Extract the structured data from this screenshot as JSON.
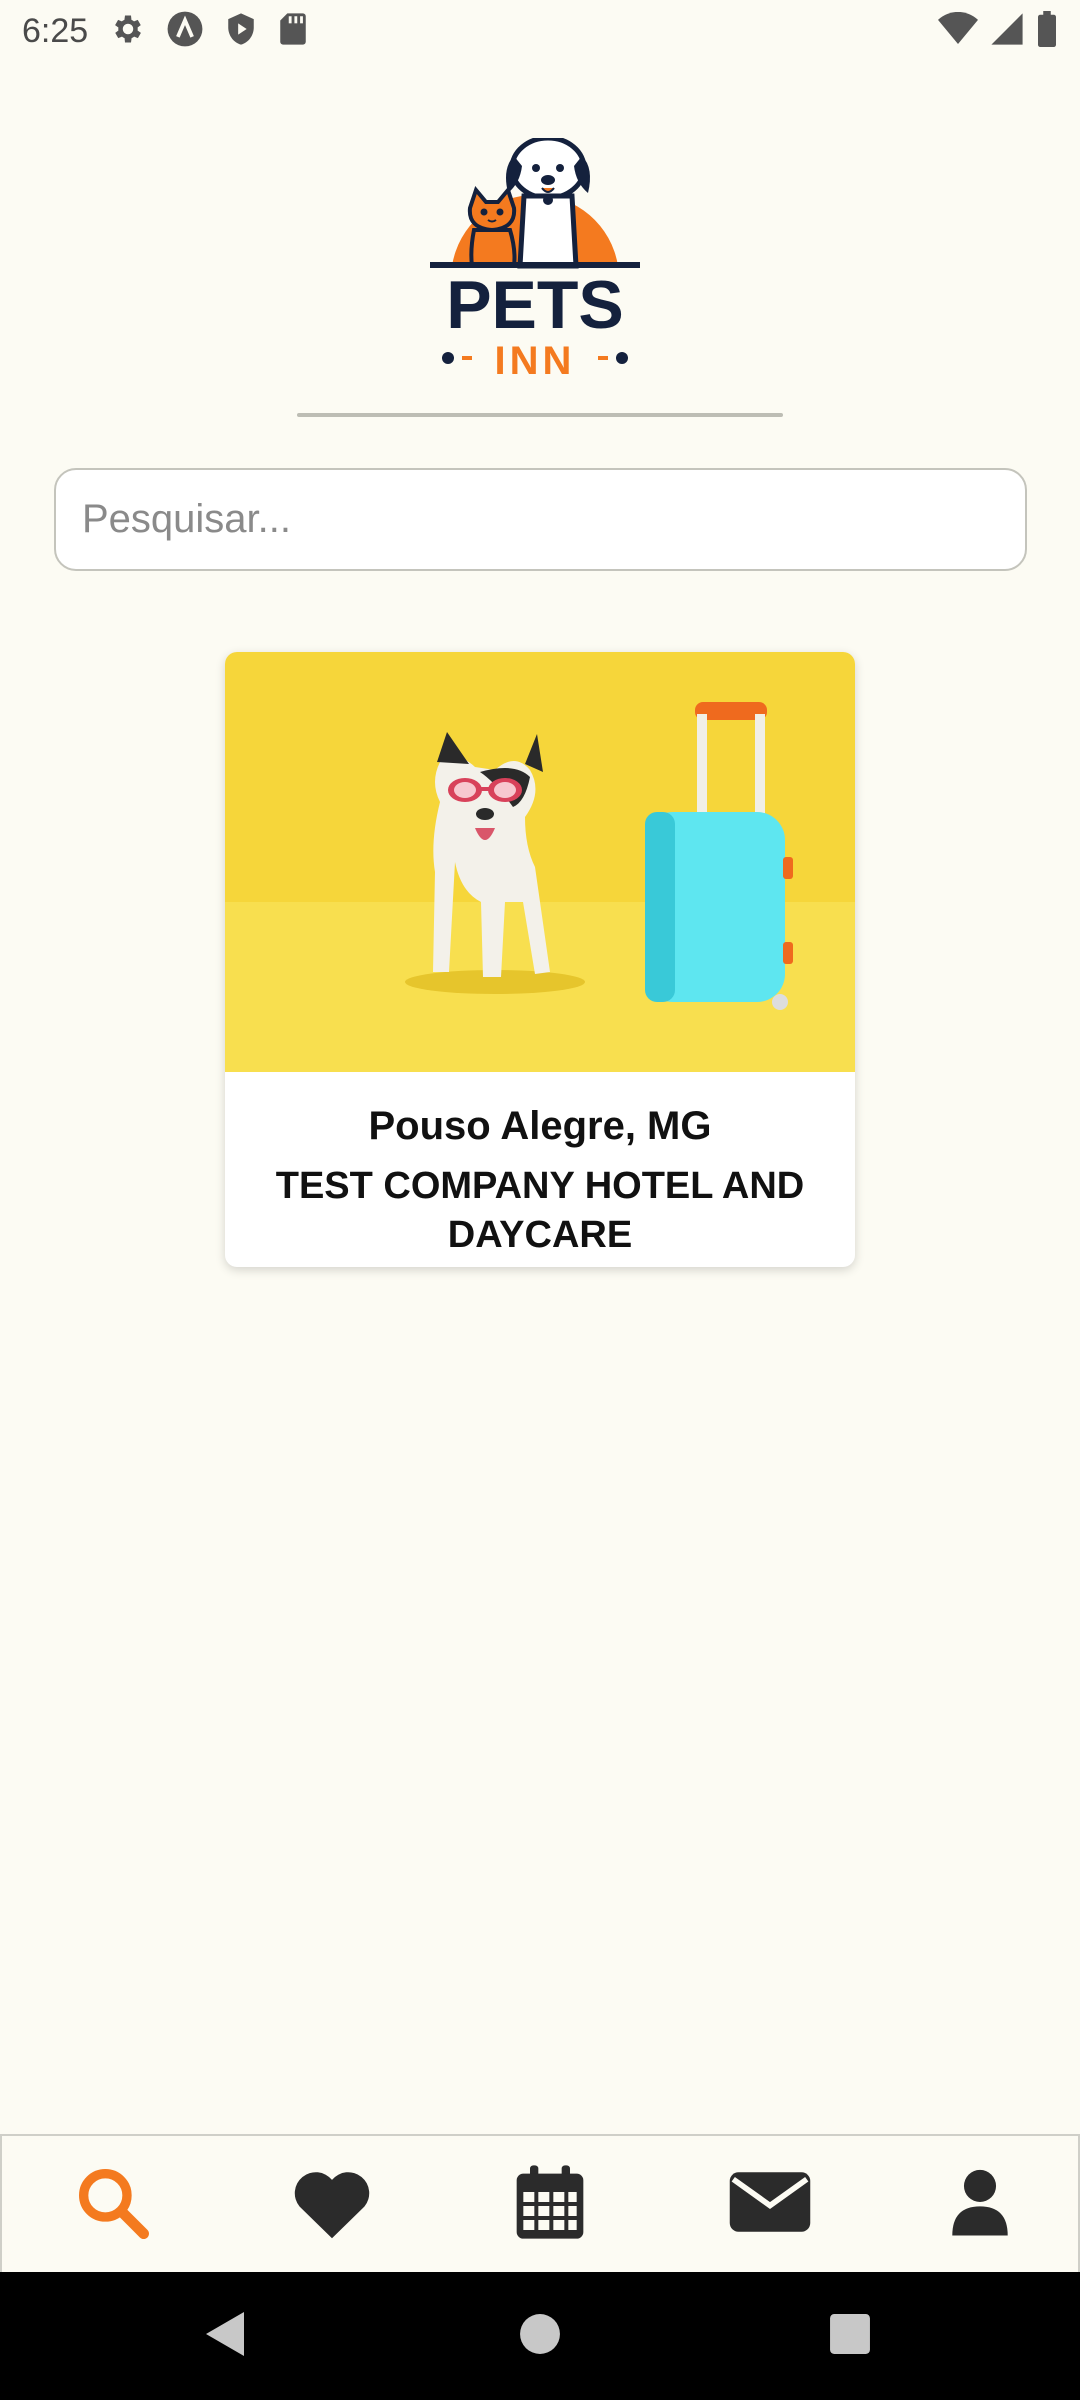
{
  "status_bar": {
    "time": "6:25",
    "left_icons": [
      "settings-icon",
      "a-circle-icon",
      "shield-play-icon",
      "sd-card-icon"
    ],
    "right_icons": [
      "wifi-icon",
      "cell-signal-icon",
      "battery-icon"
    ]
  },
  "logo": {
    "brand_top": "PETS",
    "brand_bottom": "INN"
  },
  "search": {
    "placeholder": "Pesquisar...",
    "value": ""
  },
  "listings": [
    {
      "city": "Pouso Alegre, MG",
      "name": "TEST COMPANY HOTEL AND DAYCARE",
      "image": "french-bulldog-with-suitcase"
    }
  ],
  "bottom_nav": {
    "items": [
      {
        "icon": "search-icon",
        "active": true
      },
      {
        "icon": "heart-icon",
        "active": false
      },
      {
        "icon": "calendar-icon",
        "active": false
      },
      {
        "icon": "envelope-icon",
        "active": false
      },
      {
        "icon": "user-icon",
        "active": false
      }
    ]
  },
  "colors": {
    "accent": "#f47a1f",
    "nav_icon": "#2b2b2b",
    "brand_navy": "#14213d",
    "background": "#fcfbf3"
  }
}
